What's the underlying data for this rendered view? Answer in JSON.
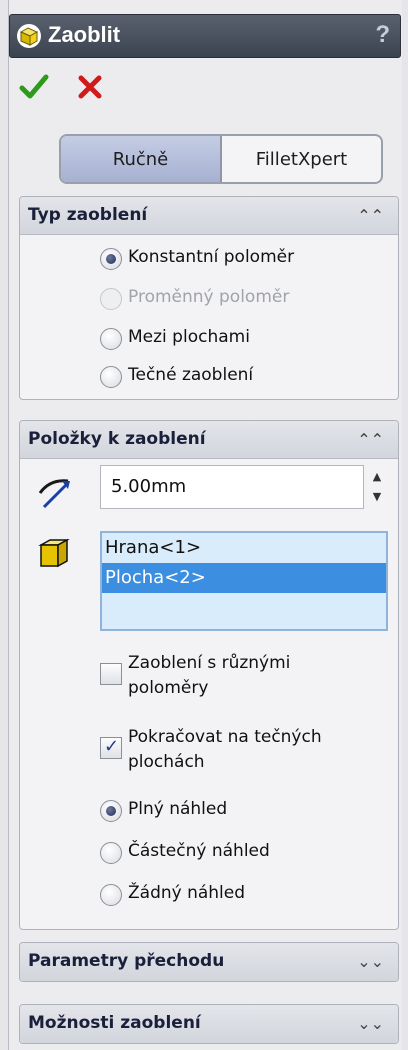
{
  "window": {
    "title": "Zaoblit",
    "help": "?"
  },
  "actions": {
    "ok": "ok-check-icon",
    "cancel": "cancel-x-icon"
  },
  "tabs": [
    {
      "label": "Ručně",
      "active": true
    },
    {
      "label": "FilletXpert",
      "active": false
    }
  ],
  "fillet_type": {
    "title": "Typ zaoblení",
    "options": [
      {
        "label": "Konstantní poloměr",
        "selected": true,
        "disabled": false
      },
      {
        "label": "Proměnný poloměr",
        "selected": false,
        "disabled": true
      },
      {
        "label": "Mezi plochami",
        "selected": false,
        "disabled": false
      },
      {
        "label": "Tečné zaoblení",
        "selected": false,
        "disabled": false
      }
    ]
  },
  "items_to_fillet": {
    "title": "Položky k zaoblení",
    "radius_value": "5.00mm",
    "entities": [
      {
        "label": "Hrana<1>",
        "selected": false
      },
      {
        "label": "Plocha<2>",
        "selected": true
      }
    ],
    "multi_radius": {
      "label_line1": "Zaoblení s různými",
      "label_line2": "poloměry",
      "checked": false
    },
    "tangent_propagation": {
      "label_line1": "Pokračovat na tečných",
      "label_line2": "plochách",
      "checked": true
    },
    "preview": [
      {
        "label": "Plný náhled",
        "selected": true
      },
      {
        "label": "Částečný náhled",
        "selected": false
      },
      {
        "label": "Žádný náhled",
        "selected": false
      }
    ]
  },
  "setback": {
    "title": "Parametry přechodu"
  },
  "fillet_options": {
    "title": "Možnosti zaoblení"
  },
  "colors": {
    "accent": "#3c8fe0",
    "title_bar": "#4a5160"
  }
}
